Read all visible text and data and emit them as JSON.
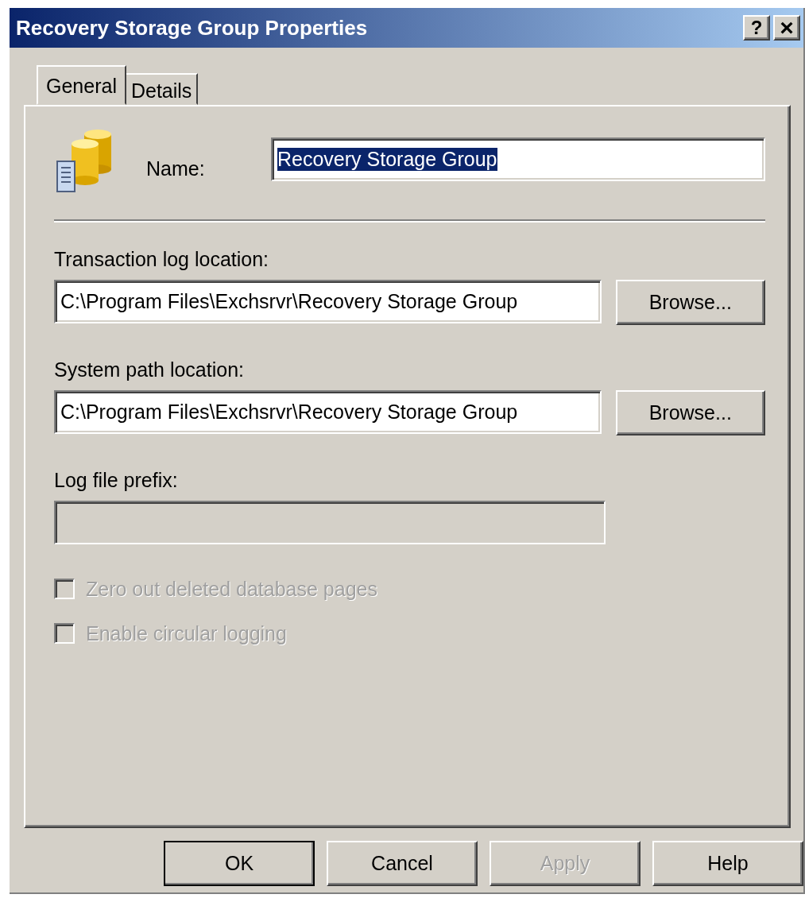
{
  "window": {
    "title": "Recovery Storage Group Properties"
  },
  "title_buttons": [
    {
      "kind": "help",
      "label": "?"
    },
    {
      "kind": "close",
      "label": "×"
    }
  ],
  "tabs": [
    {
      "label": "General",
      "selected": true
    },
    {
      "label": "Details",
      "selected": false
    }
  ],
  "name_field": {
    "label": "Name:",
    "value": "Recovery Storage Group",
    "text_selected": true
  },
  "fields": [
    {
      "label": "Transaction log location:",
      "value": "C:\\Program Files\\Exchsrvr\\Recovery Storage Group",
      "button": "Browse...",
      "disabled": false
    },
    {
      "label": "System path location:",
      "value": "C:\\Program Files\\Exchsrvr\\Recovery Storage Group",
      "button": "Browse...",
      "disabled": false
    },
    {
      "label": "Log file prefix:",
      "disabled": true
    }
  ],
  "checkboxes": [
    {
      "label": "Zero out deleted database pages",
      "checked": false,
      "disabled": true
    },
    {
      "label": "Enable circular logging",
      "checked": false,
      "disabled": true
    }
  ],
  "buttons": [
    {
      "label": "OK",
      "default": true,
      "disabled": false
    },
    {
      "label": "Cancel",
      "default": false,
      "disabled": false
    },
    {
      "label": "Apply",
      "default": false,
      "disabled": true
    },
    {
      "label": "Help",
      "default": false,
      "disabled": false
    }
  ]
}
